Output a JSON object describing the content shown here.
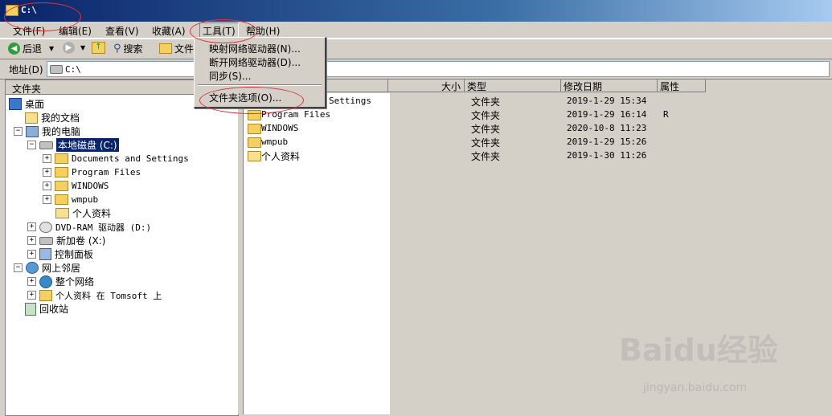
{
  "window": {
    "title": "C:\\"
  },
  "menu": [
    "文件(F)",
    "编辑(E)",
    "查看(V)",
    "收藏(A)",
    "工具(T)",
    "帮助(H)"
  ],
  "toolbar": {
    "back": "后退",
    "search": "搜索",
    "folders": "文件"
  },
  "address": {
    "label": "地址(D)",
    "value": "C:\\"
  },
  "left_pane": {
    "header": "文件夹",
    "tree": [
      {
        "label": "桌面",
        "icon": "desktop-icon"
      },
      {
        "label": "我的文档",
        "icon": "documents-icon"
      },
      {
        "label": "我的电脑",
        "icon": "computer-icon"
      },
      {
        "label": "本地磁盘 (C:)",
        "icon": "drive-icon"
      },
      {
        "label": "Documents and Settings",
        "icon": "folder-icon"
      },
      {
        "label": "Program Files",
        "icon": "folder-icon"
      },
      {
        "label": "WINDOWS",
        "icon": "folder-icon"
      },
      {
        "label": "wmpub",
        "icon": "folder-icon"
      },
      {
        "label": "个人资料",
        "icon": "folder-open-icon"
      },
      {
        "label": "DVD-RAM 驱动器 (D:)",
        "icon": "dvd-icon"
      },
      {
        "label": "新加卷 (X:)",
        "icon": "drive-icon"
      },
      {
        "label": "控制面板",
        "icon": "control-panel-icon"
      },
      {
        "label": "网上邻居",
        "icon": "network-icon"
      },
      {
        "label": "整个网络",
        "icon": "globe-icon"
      },
      {
        "label": "个人资料 在 Tomsoft 上",
        "icon": "network-share-icon"
      },
      {
        "label": "回收站",
        "icon": "recycle-bin-icon"
      }
    ]
  },
  "right_pane": {
    "columns": [
      "大小",
      "类型",
      "修改日期",
      "属性"
    ],
    "rows": [
      {
        "name": "Settings",
        "type": "文件夹",
        "date": "2019-1-29 15:34",
        "attr": ""
      },
      {
        "name": "Program Files",
        "type": "文件夹",
        "date": "2019-1-29 16:14",
        "attr": "R"
      },
      {
        "name": "WINDOWS",
        "type": "文件夹",
        "date": "2020-10-8 11:23",
        "attr": ""
      },
      {
        "name": "wmpub",
        "type": "文件夹",
        "date": "2019-1-29 15:26",
        "attr": ""
      },
      {
        "name": "个人资料",
        "type": "文件夹",
        "date": "2019-1-30 11:26",
        "attr": ""
      }
    ]
  },
  "tools_menu": {
    "items": [
      "映射网络驱动器(N)...",
      "断开网络驱动器(D)...",
      "同步(S)...",
      "文件夹选项(O)..."
    ]
  },
  "watermark": {
    "brand": "Baidu经验",
    "url": "jingyan.baidu.com"
  },
  "colors": {
    "titlebar_start": "#0a246a",
    "annotation": "#e0323a",
    "face": "#d4d0c8"
  }
}
